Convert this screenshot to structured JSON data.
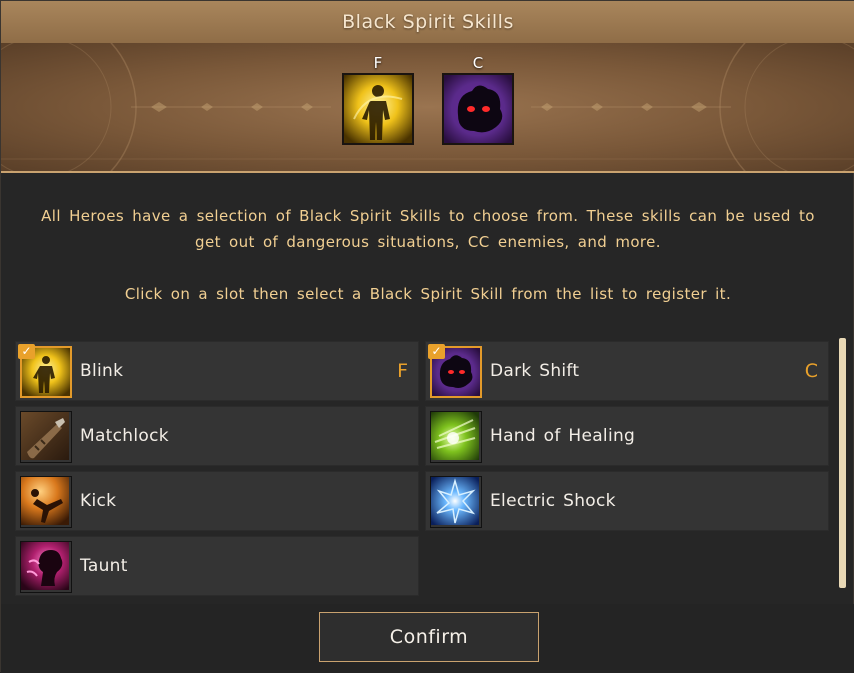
{
  "window": {
    "title": "Black Spirit Skills"
  },
  "slots": [
    {
      "key": "F",
      "icon": "blink-skill-icon"
    },
    {
      "key": "C",
      "icon": "dark-shift-skill-icon"
    }
  ],
  "description": {
    "line1": "All Heroes have a selection of Black Spirit Skills to choose from. These skills can be used to get out of dangerous situations, CC enemies, and more.",
    "line2": "Click on a slot then select a Black Spirit Skill from the list to register it."
  },
  "skills": [
    {
      "name": "Blink",
      "key": "F",
      "selected": true,
      "icon": "blink-icon"
    },
    {
      "name": "Dark Shift",
      "key": "C",
      "selected": true,
      "icon": "dark-shift-icon"
    },
    {
      "name": "Matchlock",
      "key": "",
      "selected": false,
      "icon": "matchlock-icon"
    },
    {
      "name": "Hand of Healing",
      "key": "",
      "selected": false,
      "icon": "hand-of-healing-icon"
    },
    {
      "name": "Kick",
      "key": "",
      "selected": false,
      "icon": "kick-icon"
    },
    {
      "name": "Electric Shock",
      "key": "",
      "selected": false,
      "icon": "electric-shock-icon"
    },
    {
      "name": "Taunt",
      "key": "",
      "selected": false,
      "icon": "taunt-icon"
    }
  ],
  "check_glyph": "✓",
  "footer": {
    "confirm_label": "Confirm"
  },
  "colors": {
    "accent": "#e9a12b",
    "title_bar": "#9c7a52",
    "description_text": "#f1cf92",
    "row_bg": "#343434"
  }
}
